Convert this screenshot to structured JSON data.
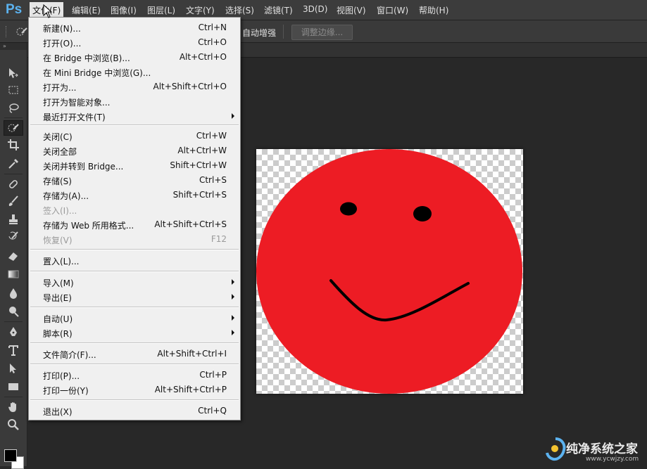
{
  "app": {
    "logo": "Ps"
  },
  "menubar": {
    "items": [
      "文件(F)",
      "编辑(E)",
      "图像(I)",
      "图层(L)",
      "文字(Y)",
      "选择(S)",
      "滤镜(T)",
      "3D(D)",
      "视图(V)",
      "窗口(W)",
      "帮助(H)"
    ],
    "active_index": 0
  },
  "options_bar": {
    "tool_icon": "quick-selection-icon",
    "auto_enhance_label": "自动增强",
    "refine_edge_label": "调整边缘..."
  },
  "toolbox": {
    "collapse_glyph": "»",
    "tools": [
      "move-icon",
      "marquee-icon",
      "lasso-icon",
      "quick-selection-icon",
      "crop-icon",
      "eyedropper-icon",
      "healing-brush-icon",
      "brush-icon",
      "clone-stamp-icon",
      "history-brush-icon",
      "eraser-icon",
      "gradient-icon",
      "blur-icon",
      "dodge-icon",
      "pen-icon",
      "type-icon",
      "path-selection-icon",
      "rectangle-icon",
      "hand-icon",
      "zoom-icon"
    ],
    "selected_tool": "quick-selection-icon",
    "foreground_color": "#000000",
    "background_color": "#ffffff"
  },
  "file_menu": {
    "groups": [
      [
        {
          "label": "新建(N)...",
          "shortcut": "Ctrl+N"
        },
        {
          "label": "打开(O)...",
          "shortcut": "Ctrl+O"
        },
        {
          "label": "在 Bridge 中浏览(B)...",
          "shortcut": "Alt+Ctrl+O"
        },
        {
          "label": "在 Mini Bridge 中浏览(G)...",
          "shortcut": ""
        },
        {
          "label": "打开为...",
          "shortcut": "Alt+Shift+Ctrl+O"
        },
        {
          "label": "打开为智能对象...",
          "shortcut": ""
        },
        {
          "label": "最近打开文件(T)",
          "shortcut": "",
          "submenu": true
        }
      ],
      [
        {
          "label": "关闭(C)",
          "shortcut": "Ctrl+W"
        },
        {
          "label": "关闭全部",
          "shortcut": "Alt+Ctrl+W"
        },
        {
          "label": "关闭并转到 Bridge...",
          "shortcut": "Shift+Ctrl+W"
        },
        {
          "label": "存储(S)",
          "shortcut": "Ctrl+S"
        },
        {
          "label": "存储为(A)...",
          "shortcut": "Shift+Ctrl+S"
        },
        {
          "label": "签入(I)...",
          "shortcut": "",
          "disabled": true
        },
        {
          "label": "存储为 Web 所用格式...",
          "shortcut": "Alt+Shift+Ctrl+S"
        },
        {
          "label": "恢复(V)",
          "shortcut": "F12",
          "disabled": true
        }
      ],
      [
        {
          "label": "置入(L)...",
          "shortcut": ""
        }
      ],
      [
        {
          "label": "导入(M)",
          "shortcut": "",
          "submenu": true
        },
        {
          "label": "导出(E)",
          "shortcut": "",
          "submenu": true
        }
      ],
      [
        {
          "label": "自动(U)",
          "shortcut": "",
          "submenu": true
        },
        {
          "label": "脚本(R)",
          "shortcut": "",
          "submenu": true
        }
      ],
      [
        {
          "label": "文件简介(F)...",
          "shortcut": "Alt+Shift+Ctrl+I"
        }
      ],
      [
        {
          "label": "打印(P)...",
          "shortcut": "Ctrl+P"
        },
        {
          "label": "打印一份(Y)",
          "shortcut": "Alt+Shift+Ctrl+P"
        }
      ],
      [
        {
          "label": "退出(X)",
          "shortcut": "Ctrl+Q"
        }
      ]
    ]
  },
  "canvas": {
    "face_color": "#ed1c24",
    "feature_color": "#000000",
    "transparent_checker": true
  },
  "watermark": {
    "title": "纯净系统之家",
    "url": "www.ycwjzy.com"
  }
}
